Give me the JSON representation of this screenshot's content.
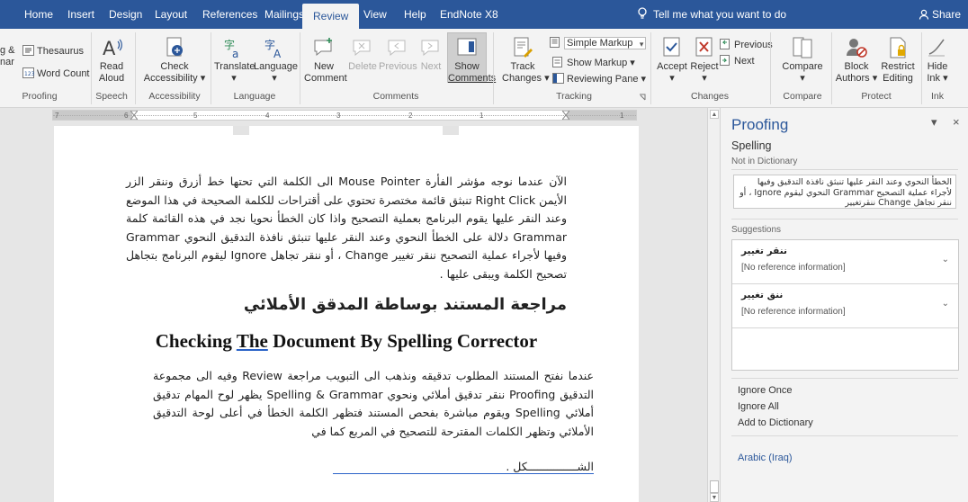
{
  "tabs": [
    "Home",
    "Insert",
    "Design",
    "Layout",
    "References",
    "Mailings",
    "Review",
    "View",
    "Help",
    "EndNote X8"
  ],
  "active_tab": "Review",
  "tell_me": "Tell me what you want to do",
  "share": "Share",
  "ribbon": {
    "proofing": {
      "thesaurus": "Thesaurus",
      "word_count": "Word Count",
      "cut_left_1": "g &",
      "cut_left_2": "nar",
      "group": "Proofing"
    },
    "speech": {
      "read_aloud_1": "Read",
      "read_aloud_2": "Aloud",
      "group": "Speech"
    },
    "accessibility": {
      "check_1": "Check",
      "check_2": "Accessibility ▾",
      "group": "Accessibility"
    },
    "language": {
      "translate": "Translate",
      "language": "Language",
      "group": "Language"
    },
    "comments": {
      "new_1": "New",
      "new_2": "Comment",
      "delete": "Delete",
      "previous": "Previous",
      "next": "Next",
      "show_1": "Show",
      "show_2": "Comments",
      "group": "Comments"
    },
    "tracking": {
      "track_1": "Track",
      "track_2": "Changes ▾",
      "simple_markup": "Simple Markup",
      "show_markup": "Show Markup ▾",
      "reviewing_pane": "Reviewing Pane ▾",
      "group": "Tracking"
    },
    "changes": {
      "accept": "Accept",
      "reject": "Reject",
      "previous": "Previous",
      "next": "Next",
      "group": "Changes"
    },
    "compare": {
      "compare": "Compare",
      "group": "Compare"
    },
    "protect": {
      "block_1": "Block",
      "block_2": "Authors ▾",
      "restrict_1": "Restrict",
      "restrict_2": "Editing",
      "group": "Protect"
    },
    "ink": {
      "hide_1": "Hide",
      "hide_2": "Ink ▾",
      "group": "Ink"
    }
  },
  "ruler_numbers": [
    "7",
    "6",
    "5",
    "4",
    "3",
    "2",
    "1",
    "1"
  ],
  "document": {
    "para1": "الآن عندما نوجه مؤشر الفأرة Mouse Pointer الى الكلمة التي تحتها خط أزرق وننقر الزر الأيمن Right Click تنبثق قائمة مختصرة تحتوي على أقتراحات للكلمة الصحيحة في هذا الموضع وعند النقر عليها يقوم البرنامج بعملية التصحيح واذا كان الخطأ نحويا نجد في هذه القائمة كلمة Grammar دلالة على الخطأ النحوي وعند النقر عليها تنبثق نافذة التدقيق النحوي Grammar وفيها لأجراء عملية التصحيح ننقر تغيير Change ، أو ننقر تجاهل Ignore ليقوم البرنامج بتجاهل تصحيح الكلمة ويبقى عليها .",
    "heading_ar": "مراجعة المستند بوساطة المدقق الأملائي",
    "heading_en_1": "Checking ",
    "heading_en_2": "The",
    "heading_en_3": " Document By Spelling Corrector",
    "para2": "عندما نفتح المستند المطلوب تدقيقه ونذهب الى التبويب مراجعة Review وفيه الى مجموعة التدقيق Proofing ننقر تدقيق أملائي ونحوي Spelling & Grammar يظهر لوح المهام تدقيق أملائي Spelling ويقوم مباشرة بفحص المستند فتظهر الكلمة الخطأ في أعلى لوحة التدقيق الأملائي وتظهر الكلمات المقترحة للتصحيح في المربع كما في",
    "para2_last": "الشـــــــــــــــكل ."
  },
  "pane": {
    "title": "Proofing",
    "dropdown_icon": "▾",
    "close_icon": "×",
    "mode": "Spelling",
    "not_in_dictionary": "Not in Dictionary",
    "context": "الخطأ النحوي وعند النقر عليها تنبثق نافذة التدقيق وفيها لأجراء عملية التصحيح Grammar النحوي ليقوم Ignore ، أو ننقر تجاهل Change ننقرتغيير",
    "suggestions_label": "Suggestions",
    "suggestions": [
      {
        "word": "ننقر تغيير",
        "ref": "[No reference information]"
      },
      {
        "word": "ننق تغيير",
        "ref": "[No reference information]"
      }
    ],
    "ignore_once": "Ignore Once",
    "ignore_all": "Ignore All",
    "add_to_dictionary": "Add to Dictionary",
    "language": "Arabic (Iraq)"
  }
}
